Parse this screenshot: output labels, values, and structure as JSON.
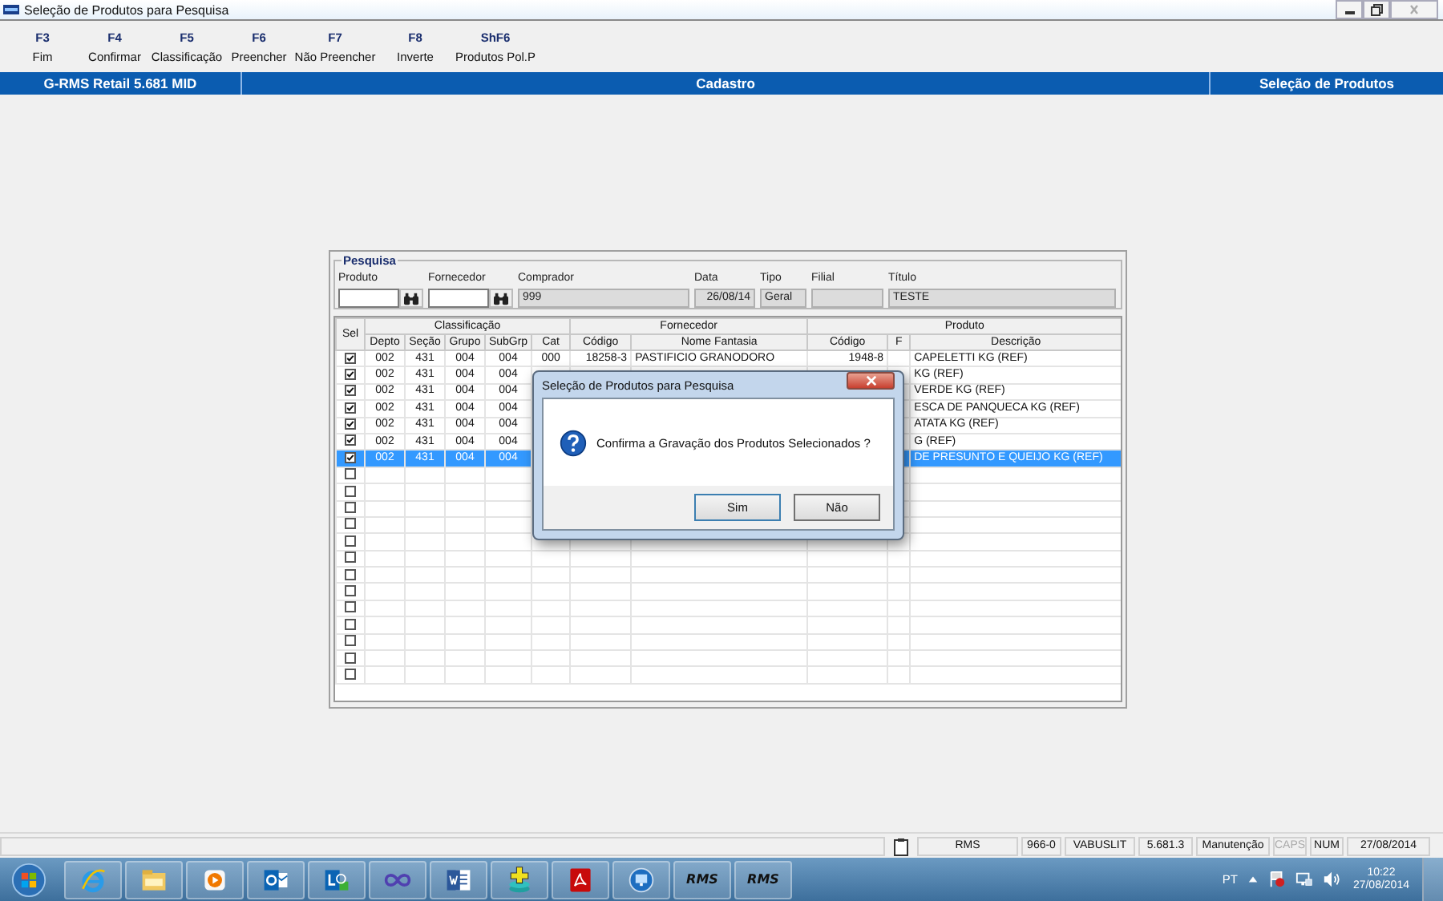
{
  "window": {
    "title": "Seleção de Produtos para Pesquisa"
  },
  "toolbar": [
    {
      "key": "F3",
      "label": "Fim"
    },
    {
      "key": "F4",
      "label": "Confirmar"
    },
    {
      "key": "F5",
      "label": "Classificação"
    },
    {
      "key": "F6",
      "label": "Preencher"
    },
    {
      "key": "F7",
      "label": "Não Preencher"
    },
    {
      "key": "F8",
      "label": "Inverte"
    },
    {
      "key": "ShF6",
      "label": "Produtos Pol.P"
    }
  ],
  "header_bar": [
    "G-RMS Retail 5.681 MID",
    "Cadastro",
    "Seleção de Produtos"
  ],
  "search": {
    "title": "Pesquisa",
    "fields": [
      {
        "label": "Produto",
        "kind": "lookup"
      },
      {
        "label": "Fornecedor",
        "kind": "lookup"
      },
      {
        "label": "Comprador",
        "kind": "readonly",
        "value": "999"
      },
      {
        "label": "Data",
        "kind": "readonly",
        "value": "26/08/14"
      },
      {
        "label": "Tipo",
        "kind": "readonly",
        "value": "Geral"
      },
      {
        "label": "Filial",
        "kind": "readonly"
      },
      {
        "label": "Título",
        "kind": "readonly",
        "value": "TESTE"
      }
    ]
  },
  "table": {
    "sel_header": "Sel",
    "groups": [
      {
        "label": "Classificação"
      },
      {
        "label": "Fornecedor"
      },
      {
        "label": "Produto"
      }
    ],
    "columns": [
      "Depto",
      "Seção",
      "Grupo",
      "SubGrp",
      "Cat",
      "Código",
      "Nome Fantasia",
      "Código",
      "F",
      "Descrição"
    ],
    "rows": [
      {
        "checked": true,
        "selected": false,
        "depto": "002",
        "secao": "431",
        "grupo": "004",
        "subgrp": "004",
        "cat": "000",
        "forn_codigo": "18258-3",
        "nome_fantasia": "PASTIFICIO GRANODORO",
        "prod_codigo": "1948-8",
        "descricao": "CAPELETTI KG (REF)"
      },
      {
        "checked": true,
        "selected": false,
        "depto": "002",
        "secao": "431",
        "grupo": "004",
        "subgrp": "004",
        "descricao": "KG (REF)"
      },
      {
        "checked": true,
        "selected": false,
        "depto": "002",
        "secao": "431",
        "grupo": "004",
        "subgrp": "004",
        "descricao": "VERDE KG (REF)"
      },
      {
        "checked": true,
        "selected": false,
        "depto": "002",
        "secao": "431",
        "grupo": "004",
        "subgrp": "004",
        "descricao": "ESCA DE PANQUECA KG (REF)"
      },
      {
        "checked": true,
        "selected": false,
        "depto": "002",
        "secao": "431",
        "grupo": "004",
        "subgrp": "004",
        "descricao": "ATATA KG (REF)"
      },
      {
        "checked": true,
        "selected": false,
        "depto": "002",
        "secao": "431",
        "grupo": "004",
        "subgrp": "004",
        "descricao": "G (REF)"
      },
      {
        "checked": true,
        "selected": true,
        "depto": "002",
        "secao": "431",
        "grupo": "004",
        "subgrp": "004",
        "descricao": "DE PRESUNTO E QUEIJO KG (REF)"
      },
      {
        "checked": false,
        "selected": false
      },
      {
        "checked": false,
        "selected": false
      },
      {
        "checked": false,
        "selected": false
      },
      {
        "checked": false,
        "selected": false
      },
      {
        "checked": false,
        "selected": false
      },
      {
        "checked": false,
        "selected": false
      },
      {
        "checked": false,
        "selected": false
      },
      {
        "checked": false,
        "selected": false
      },
      {
        "checked": false,
        "selected": false
      },
      {
        "checked": false,
        "selected": false
      },
      {
        "checked": false,
        "selected": false
      },
      {
        "checked": false,
        "selected": false
      },
      {
        "checked": false,
        "selected": false
      }
    ]
  },
  "dialog": {
    "title": "Seleção de Produtos para Pesquisa",
    "message": "Confirma a Gravação dos Produtos Selecionados ?",
    "buttons": [
      "Sim",
      "Não"
    ]
  },
  "status_bar": [
    {
      "text": "RMS",
      "active": true
    },
    {
      "text": "966-0",
      "active": true
    },
    {
      "text": "VABUSLIT",
      "active": true
    },
    {
      "text": "5.681.3",
      "active": true
    },
    {
      "text": "Manutenção",
      "active": true
    },
    {
      "text": "CAPS",
      "active": false
    },
    {
      "text": "NUM",
      "active": true
    },
    {
      "text": "27/08/2014",
      "active": true
    }
  ],
  "taskbar": {
    "apps": [
      {
        "kind": "ie"
      },
      {
        "kind": "folder"
      },
      {
        "kind": "media"
      },
      {
        "kind": "outlook"
      },
      {
        "kind": "lync"
      },
      {
        "kind": "infinity"
      },
      {
        "kind": "word"
      },
      {
        "kind": "database"
      },
      {
        "kind": "pdf"
      },
      {
        "kind": "remote"
      },
      {
        "kind": "rms",
        "text": "RMS"
      },
      {
        "kind": "rms",
        "text": "RMS"
      }
    ],
    "tray": {
      "language": "PT",
      "time": "10:22",
      "date": "27/08/2014"
    }
  }
}
